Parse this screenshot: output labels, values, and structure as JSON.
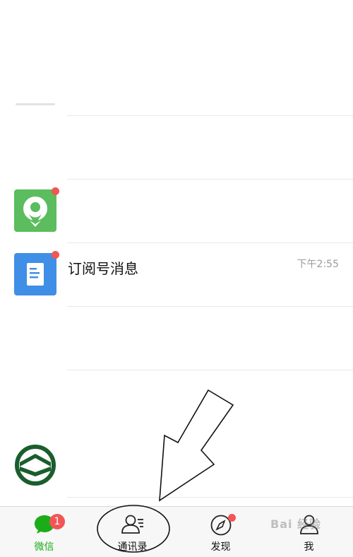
{
  "chats": [
    {
      "title": "",
      "time": "",
      "avatar": "grey-placeholder",
      "unread_dot": false
    },
    {
      "title": "",
      "time": "",
      "avatar": "none",
      "unread_dot": false
    },
    {
      "title": "",
      "time": "",
      "avatar": "green-location-app",
      "unread_dot": true
    },
    {
      "title": "订阅号消息",
      "time": "下午2:55",
      "avatar": "blue-document-icon",
      "unread_dot": true
    },
    {
      "title": "",
      "time": "",
      "avatar": "none",
      "unread_dot": false
    },
    {
      "title": "",
      "time": "",
      "avatar": "none",
      "unread_dot": false
    },
    {
      "title": "",
      "time": "",
      "avatar": "green-circle-logo",
      "unread_dot": false
    }
  ],
  "tabbar": {
    "tabs": [
      {
        "label": "微信",
        "icon": "chat-bubble-icon",
        "active": true,
        "badge": "1"
      },
      {
        "label": "通讯录",
        "icon": "contacts-icon",
        "active": false,
        "badge": ""
      },
      {
        "label": "发现",
        "icon": "compass-icon",
        "active": false,
        "dot": true
      },
      {
        "label": "我",
        "icon": "person-icon",
        "active": false
      }
    ]
  },
  "watermark": "Bai 经验",
  "colors": {
    "accent": "#1aad19",
    "badge": "#f25555",
    "doc_blue": "#3f8fe6",
    "app_green": "#5bbd5e",
    "logo_green": "#1a5e2c"
  }
}
